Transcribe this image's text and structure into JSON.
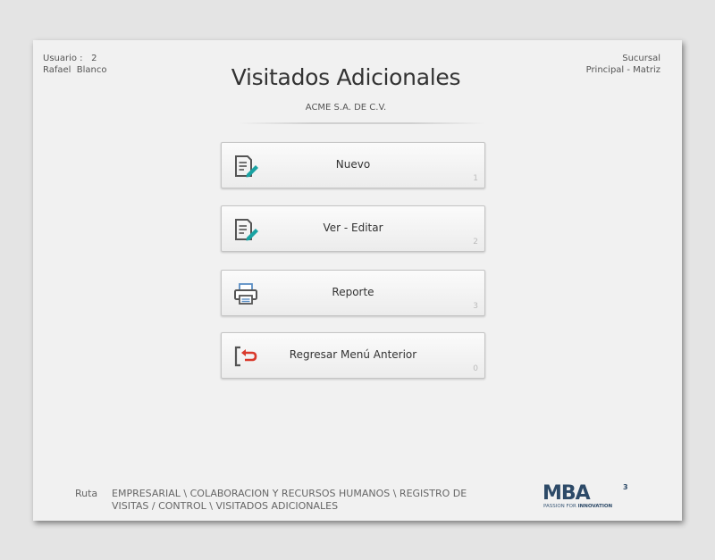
{
  "header": {
    "user_label": "Usuario :",
    "user_id": "2",
    "user_name": "Rafael  Blanco",
    "branch_label": "Sucursal",
    "branch_name": "Principal - Matriz",
    "title": "Visitados Adicionales",
    "company": "ACME S.A. DE C.V."
  },
  "menu": [
    {
      "label": "Nuevo",
      "key": "1",
      "icon": "new-document-icon"
    },
    {
      "label": "Ver - Editar",
      "key": "2",
      "icon": "edit-document-icon"
    },
    {
      "label": "Reporte",
      "key": "3",
      "icon": "printer-icon"
    },
    {
      "label": "Regresar Menú Anterior",
      "key": "0",
      "icon": "exit-back-icon"
    }
  ],
  "footer": {
    "route_label": "Ruta",
    "route_path": "EMPRESARIAL \\ COLABORACION Y RECURSOS HUMANOS \\ REGISTRO DE VISITAS / CONTROL \\ VISITADOS ADICIONALES",
    "logo_text": "MBA",
    "logo_sup": "3",
    "logo_tagline_a": "PASSION FOR ",
    "logo_tagline_b": "INNOVATION"
  },
  "colors": {
    "icon_gray": "#555555",
    "accent_teal": "#1aa3a3",
    "exit_red": "#d9392b",
    "printer_blue": "#5b8ec4",
    "logo_blue": "#2d4a68"
  }
}
